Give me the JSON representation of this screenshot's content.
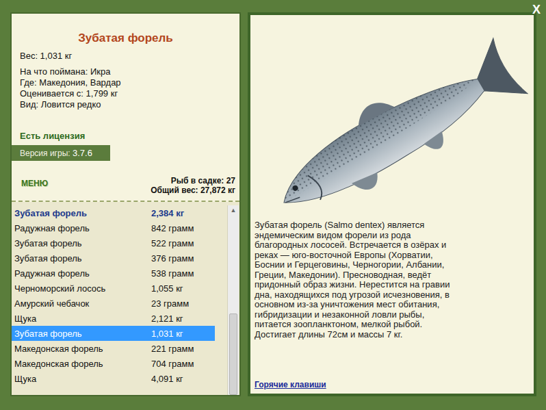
{
  "fish_card": {
    "title": "Зубатая форель",
    "weight": "Вес: 1,031 кг",
    "details": [
      "На что поймана: Икра",
      "Где: Македония, Вардар",
      "Оценивается с: 1,799 кг",
      "Вид: Ловится редко"
    ],
    "license": "Есть лицензия",
    "version_label": "Версия игры:",
    "version": "3.7.6"
  },
  "menu_button": "МЕНЮ",
  "cage": {
    "count": "Рыб в садке: 27",
    "total": "Общий вес: 27,872 кг"
  },
  "catch_list": [
    {
      "name": "Зубатая форель",
      "weight": "2,384 кг",
      "record": true,
      "selected": false
    },
    {
      "name": "Радужная форель",
      "weight": "842 грамм",
      "record": false,
      "selected": false
    },
    {
      "name": "Зубатая форель",
      "weight": "522 грамм",
      "record": false,
      "selected": false
    },
    {
      "name": "Зубатая форель",
      "weight": "376 грамм",
      "record": false,
      "selected": false
    },
    {
      "name": "Радужная форель",
      "weight": "538 грамм",
      "record": false,
      "selected": false
    },
    {
      "name": "Черноморский лосось",
      "weight": "1,055 кг",
      "record": false,
      "selected": false
    },
    {
      "name": "Амурский чебачок",
      "weight": "23 грамм",
      "record": false,
      "selected": false
    },
    {
      "name": "Щука",
      "weight": "2,121 кг",
      "record": false,
      "selected": false
    },
    {
      "name": "Зубатая форель",
      "weight": "1,031 кг",
      "record": false,
      "selected": true
    },
    {
      "name": "Македонская форель",
      "weight": "221 грамм",
      "record": false,
      "selected": false
    },
    {
      "name": "Македонская форель",
      "weight": "704 грамм",
      "record": false,
      "selected": false
    },
    {
      "name": "Щука",
      "weight": "4,091 кг",
      "record": false,
      "selected": false
    }
  ],
  "scrollbar": {
    "up": "▲",
    "level": 0.45,
    "position": 1
  },
  "description": "Зубатая форель (Salmo dentex) является эндемическим видом форели из рода благородных лососей. Встречается в озёрах и реках — юго-восточной Европы (Хорватии, Боснии и Герцеговины, Черногории, Албании, Греции, Македонии). Пресноводная, ведёт придонный образ жизни. Нерестится на гравии дна, находящихся под угрозой исчезновения, в основном из-за уничтожения мест обитания, гибридизации и незаконной ловли рыбы, питается зоопланктоном, мелкой рыбой. Достигает длины 72см и массы 7 кг.",
  "hotkeys_link": "Горячие клавиши",
  "close": "X"
}
